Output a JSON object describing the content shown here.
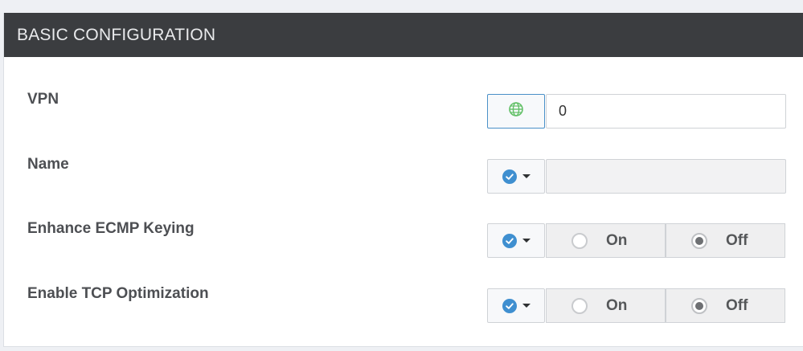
{
  "section": {
    "title": "BASIC CONFIGURATION"
  },
  "fields": [
    {
      "label": "VPN",
      "scope": "global",
      "value": "0"
    },
    {
      "label": "Name",
      "scope": "device",
      "value": ""
    },
    {
      "label": "Enhance ECMP Keying",
      "scope": "default",
      "options": [
        "On",
        "Off"
      ],
      "selected": "Off"
    },
    {
      "label": "Enable TCP Optimization",
      "scope": "default",
      "options": [
        "On",
        "Off"
      ],
      "selected": "Off"
    }
  ],
  "colors": {
    "header_bg": "#3b3d40",
    "check_blue": "#3f8fd0",
    "globe_green": "#62c067"
  },
  "icons": {
    "global_scope": "globe-icon",
    "default_scope": "check-circle-icon",
    "dropdown": "caret-down-icon"
  }
}
